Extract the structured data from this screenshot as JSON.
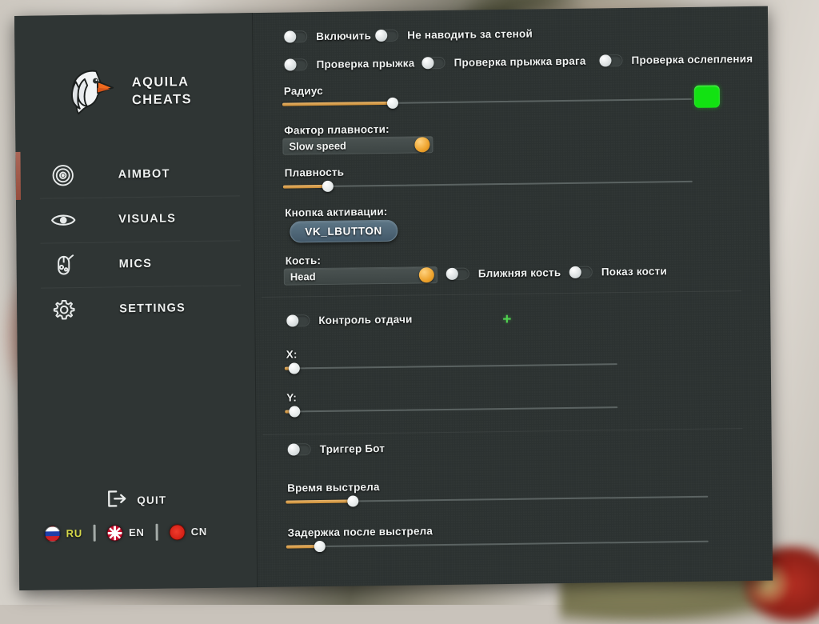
{
  "app": {
    "brand_line1": "AQUILA",
    "brand_line2": "CHEATS"
  },
  "sidebar": {
    "items": [
      {
        "label": "AIMBOT",
        "icon": "crosshair-icon",
        "active": true
      },
      {
        "label": "VISUALS",
        "icon": "eye-icon",
        "active": false
      },
      {
        "label": "MICS",
        "icon": "mouse-icon",
        "active": false
      },
      {
        "label": "SETTINGS",
        "icon": "gear-icon",
        "active": false
      }
    ],
    "quit_label": "QUIT",
    "quit_icon": "exit-icon",
    "languages": [
      {
        "code": "RU",
        "flag": "flag-ru",
        "active": true
      },
      {
        "code": "EN",
        "flag": "flag-en",
        "active": false
      },
      {
        "code": "CN",
        "flag": "flag-cn",
        "active": false
      }
    ]
  },
  "aimbot": {
    "toggles_row1": [
      {
        "label": "Включить",
        "on": false
      },
      {
        "label": "Не наводить за стеной",
        "on": false
      }
    ],
    "toggles_row2": [
      {
        "label": "Проверка прыжка",
        "on": false
      },
      {
        "label": "Проверка прыжка врага",
        "on": false
      },
      {
        "label": "Проверка ослепления",
        "on": false
      }
    ],
    "radius": {
      "label": "Радиус",
      "value_pct": 27
    },
    "radius_color": "#12e212",
    "smooth_factor": {
      "label": "Фактор плавности:",
      "value": "Slow speed"
    },
    "smoothness": {
      "label": "Плавность",
      "value_pct": 11
    },
    "activation_key": {
      "label": "Кнопка активации:",
      "value": "VK_LBUTTON"
    },
    "bone": {
      "label": "Кость:",
      "value": "Head"
    },
    "bone_toggles": [
      {
        "label": "Ближняя кость",
        "on": false
      },
      {
        "label": "Показ кости",
        "on": false
      }
    ]
  },
  "recoil": {
    "toggle": {
      "label": "Контроль отдачи",
      "on": false
    },
    "add_icon": "plus-icon",
    "x": {
      "label": "X:",
      "value_pct": 3
    },
    "y": {
      "label": "Y:",
      "value_pct": 3
    }
  },
  "triggerbot": {
    "toggle": {
      "label": "Триггер Бот",
      "on": false
    },
    "shot_time": {
      "label": "Время выстрела",
      "value_pct": 16
    },
    "delay_after_shot": {
      "label": "Задержка после выстрела",
      "value_pct": 8
    }
  }
}
